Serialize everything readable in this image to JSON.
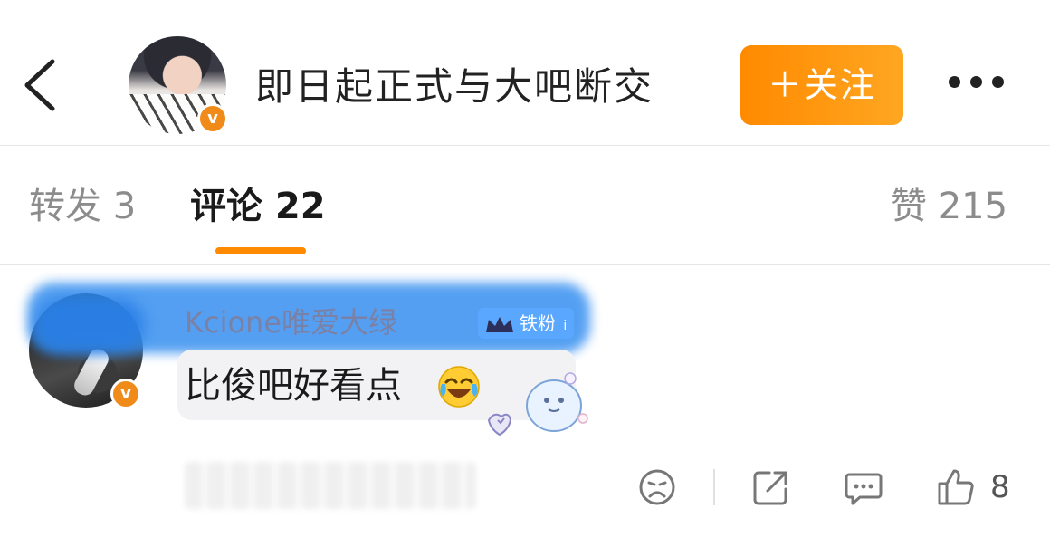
{
  "header": {
    "title": "即日起正式与大吧断交",
    "follow_label": "＋关注",
    "accent_color": "#ff8a00",
    "back_icon": "chevron-left-icon",
    "more_icon": "more-horizontal-icon",
    "verified_badge": "v"
  },
  "tabs": {
    "reposts": "转发 3",
    "comments": "评论 22",
    "likes": "赞 215"
  },
  "comment": {
    "username": "Kcione唯爱大绿",
    "fan_badge": "铁粉",
    "fan_badge_level": "i",
    "text": "比俊吧好看点",
    "verified_badge": "v",
    "emoji": "laughing-crying-emoji",
    "sticker": "cute-ghost-sticker",
    "actions": {
      "dislike_icon": "sad-face-icon",
      "share_icon": "share-icon",
      "comment_icon": "comment-icon",
      "like_icon": "thumbs-up-icon",
      "like_count": "8"
    }
  }
}
